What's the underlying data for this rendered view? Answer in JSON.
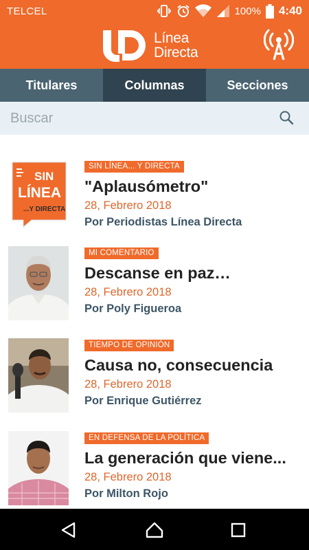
{
  "status_bar": {
    "carrier": "TELCEL",
    "battery_percent": "100%",
    "time": "4:40",
    "icons": [
      "vibrate-icon",
      "alarm-icon",
      "wifi-icon",
      "cell-signal-icon",
      "battery-icon"
    ]
  },
  "header": {
    "logo_mark": "LD",
    "logo_line1": "Línea",
    "logo_line2": "Directa",
    "live_radio_icon": "radio-antenna-icon"
  },
  "tabs": [
    {
      "label": "Titulares",
      "active": false
    },
    {
      "label": "Columnas",
      "active": true
    },
    {
      "label": "Secciones",
      "active": false
    }
  ],
  "search": {
    "placeholder": "Buscar",
    "value": "",
    "icon": "search-icon"
  },
  "columns": [
    {
      "section": "SIN LÍNEA... Y DIRECTA",
      "title": "\"Aplausómetro\"",
      "date": "28, Febrero 2018",
      "author": "Por Periodistas Línea Directa",
      "thumb": {
        "line1": "SIN",
        "line2": "LÍNEA",
        "line3": "...Y DIRECTA"
      }
    },
    {
      "section": "MI COMENTARIO",
      "title": "Descanse en paz…",
      "date": "28, Febrero 2018",
      "author": "Por Poly Figueroa"
    },
    {
      "section": "TIEMPO DE OPINIÓN",
      "title": "Causa no, consecuencia",
      "date": "28, Febrero 2018",
      "author": "Por Enrique Gutiérrez"
    },
    {
      "section": "EN DEFENSA DE LA POLÍTICA",
      "title": "La generación que viene...",
      "date": "28, Febrero 2018",
      "author": "Por Milton Rojo"
    }
  ],
  "nav_bar": {
    "icons": [
      "back-icon",
      "home-icon",
      "recents-icon"
    ]
  },
  "colors": {
    "brand_orange": "#ef6a2b",
    "tab_bar": "#4b6472",
    "tab_active": "#2f4350",
    "search_bg": "#e9f0f5",
    "author_text": "#3c5566"
  }
}
